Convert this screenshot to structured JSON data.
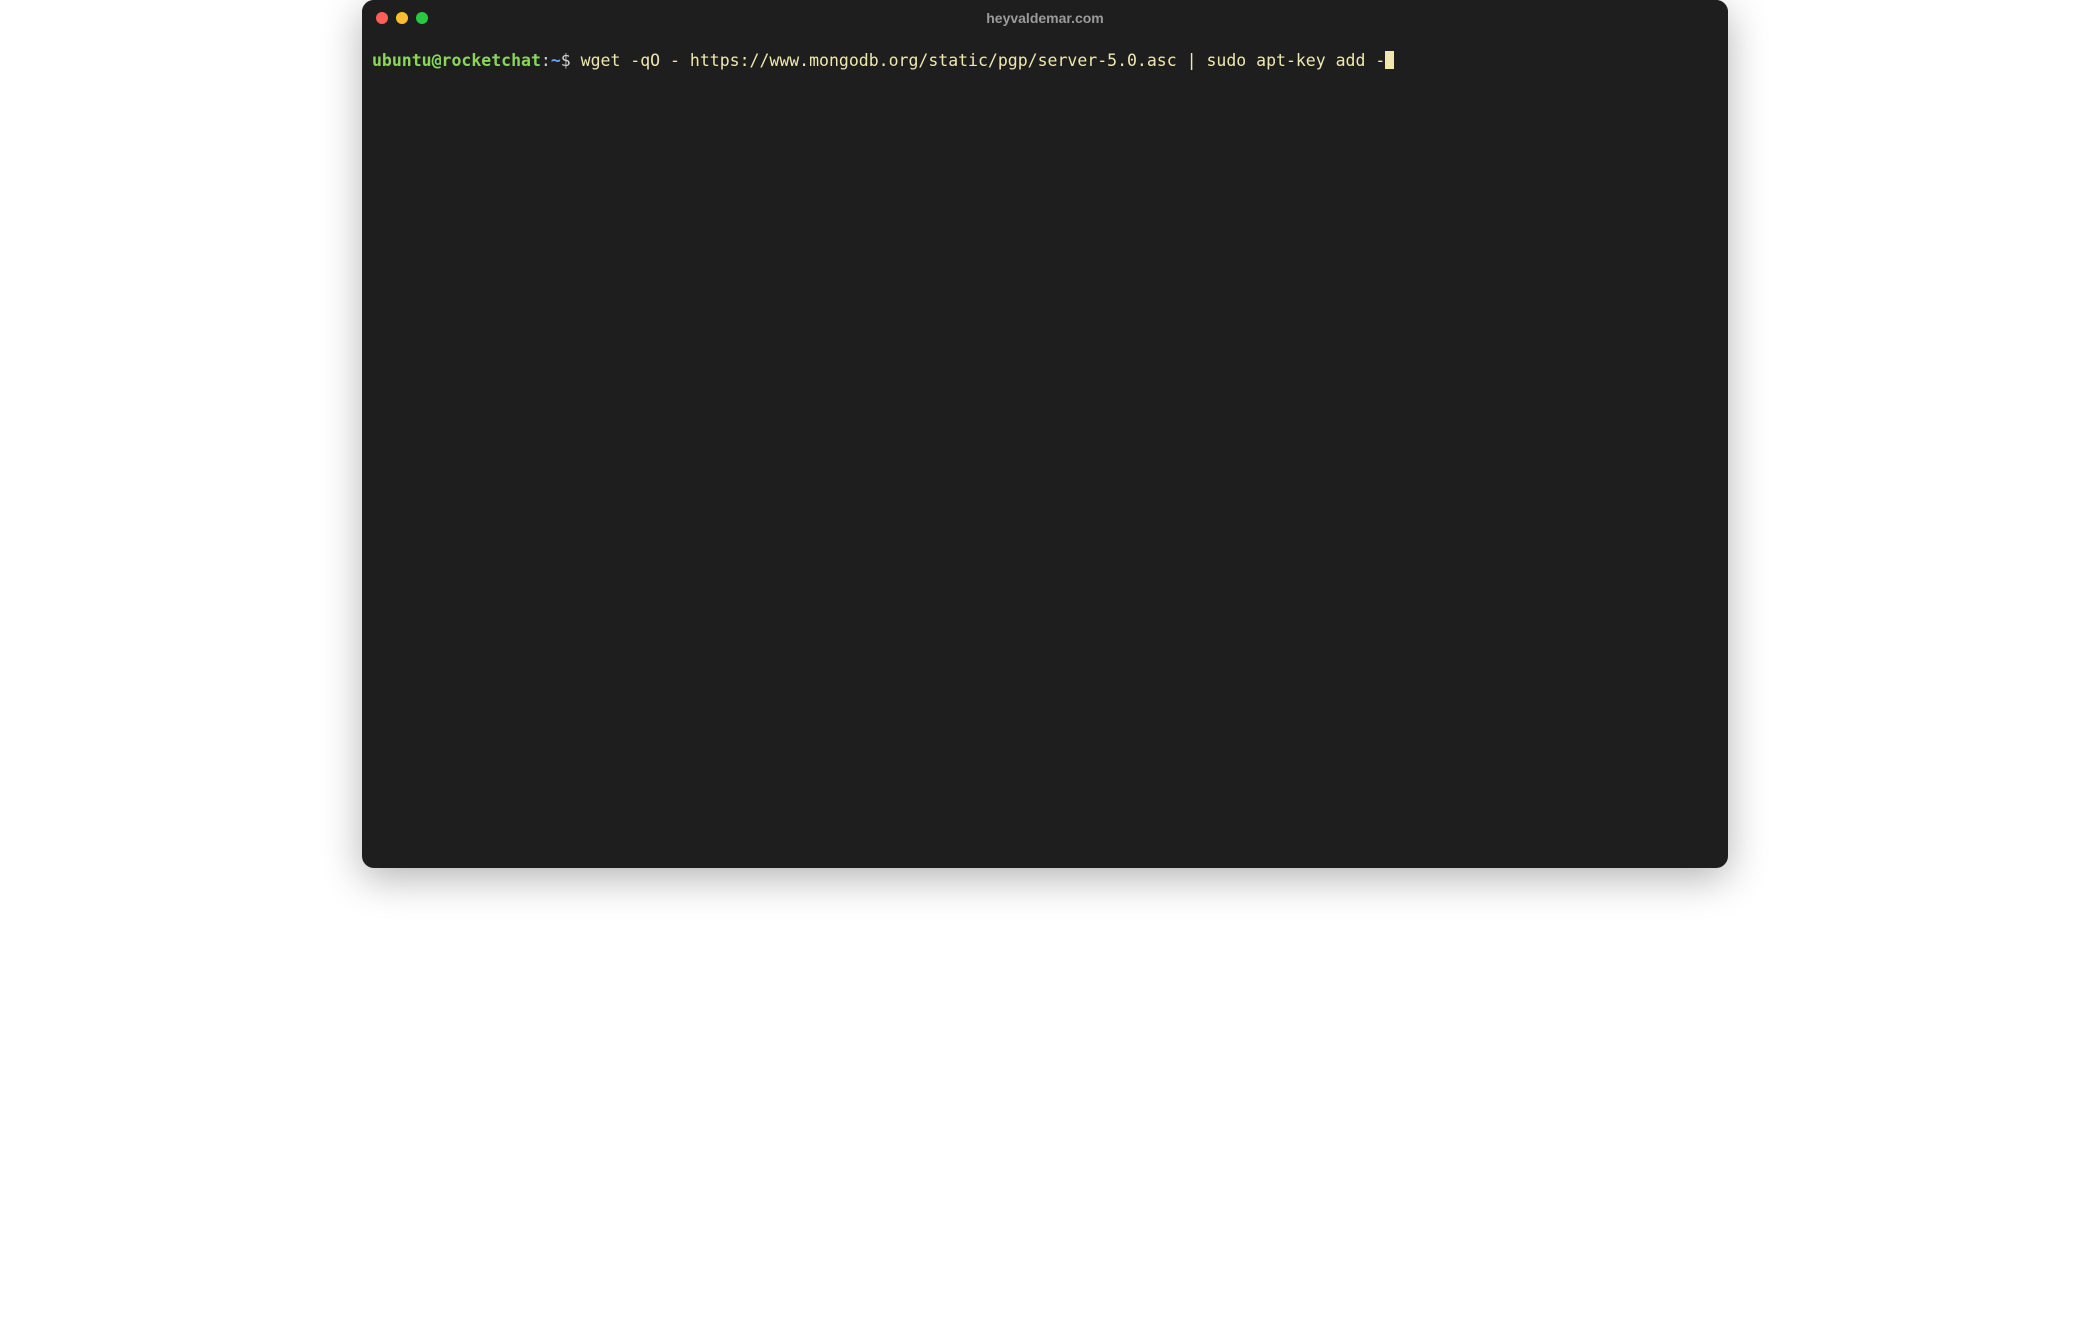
{
  "window": {
    "title": "heyvaldemar.com"
  },
  "prompt": {
    "user_host": "ubuntu@rocketchat",
    "separator": ":",
    "path": "~",
    "symbol": "$"
  },
  "command": "wget -qO - https://www.mongodb.org/static/pgp/server-5.0.asc | sudo apt-key add -",
  "colors": {
    "bg": "#1e1e1e",
    "prompt_user": "#8bd55b",
    "prompt_path": "#6aa3f5",
    "command": "#f0e7b0",
    "title": "#9b9b9b",
    "close": "#ff5f57",
    "minimize": "#febc2e",
    "maximize": "#28c840"
  }
}
